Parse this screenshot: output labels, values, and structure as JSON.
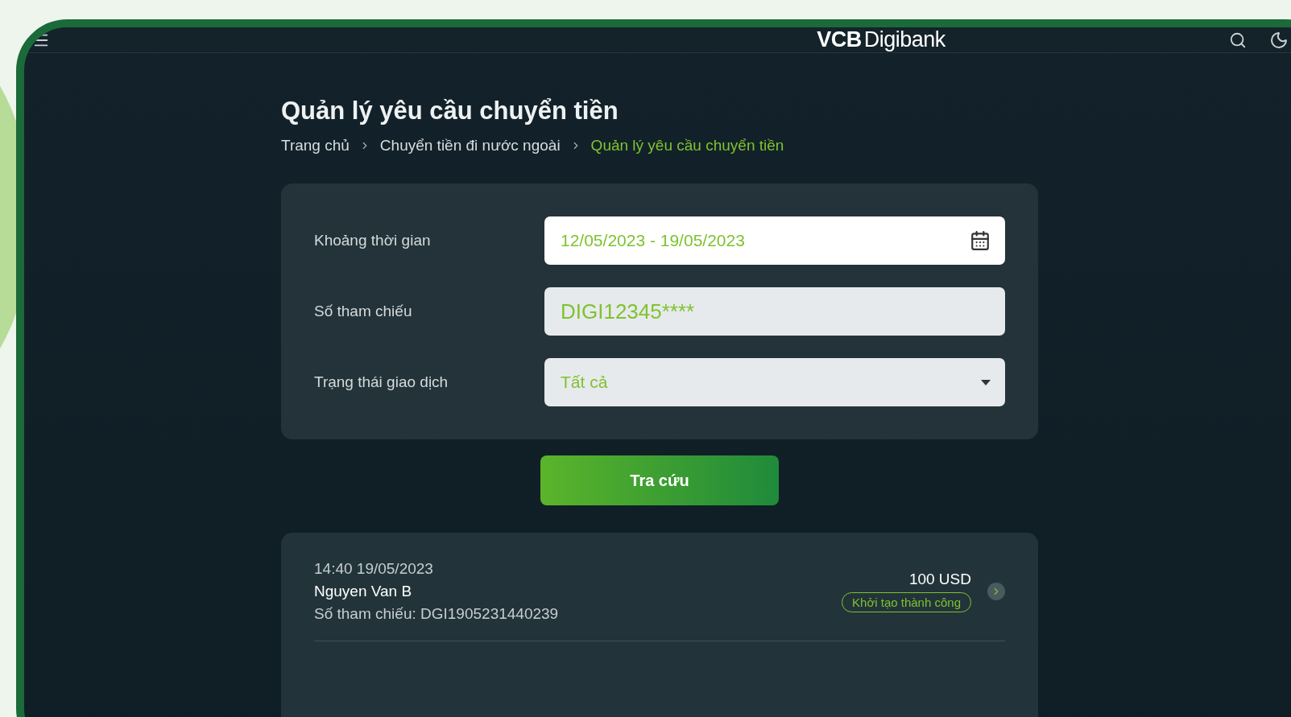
{
  "header": {
    "logo": {
      "bold": "VCB",
      "light": "Digibank"
    }
  },
  "page": {
    "title": "Quản lý yêu cầu chuyển tiền"
  },
  "breadcrumb": [
    {
      "label": "Trang chủ",
      "selected": false
    },
    {
      "label": "Chuyển tiền đi nước ngoài",
      "selected": false
    },
    {
      "label": "Quản lý yêu cầu chuyển tiền",
      "selected": true
    }
  ],
  "filters": [
    {
      "kind": "date",
      "label": "Khoảng thời gian",
      "value": "12/05/2023 - 19/05/2023"
    },
    {
      "kind": "text",
      "label": "Số tham chiếu",
      "value": "DIGI12345****"
    },
    {
      "kind": "select",
      "label": "Trạng thái giao dịch",
      "value": "Tất cả"
    }
  ],
  "search_button": "Tra cứu",
  "results": [
    {
      "time": "14:40 19/05/2023",
      "name": "Nguyen Van B",
      "reference": "Số tham chiếu: DGI1905231440239",
      "amount": "100 USD",
      "status": "Khởi tạo thành công"
    }
  ]
}
